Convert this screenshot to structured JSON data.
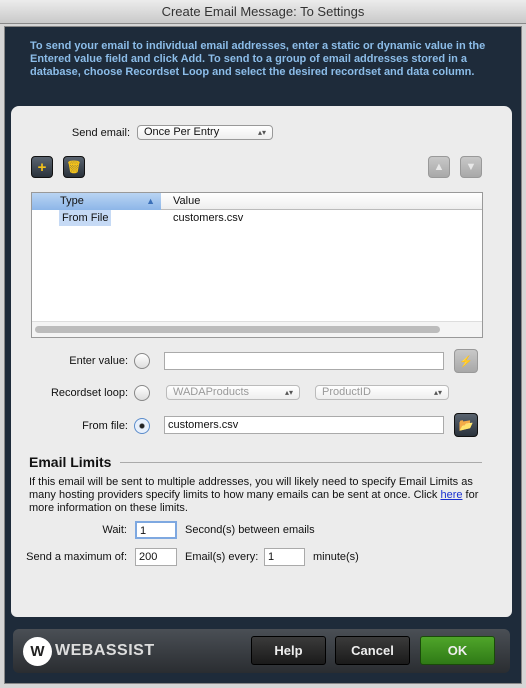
{
  "window": {
    "title": "Create Email Message: To Settings"
  },
  "intro": "To send your email to individual email addresses, enter a static or dynamic value in the Entered value field and click Add. To send to a group of email addresses stored in a database, choose Recordset Loop and select the desired recordset and data column.",
  "send_email": {
    "label": "Send email:",
    "value": "Once Per Entry"
  },
  "toolbar": {
    "add_icon": "plus-icon",
    "delete_icon": "trash-icon",
    "up_icon": "arrow-up-icon",
    "down_icon": "arrow-down-icon"
  },
  "table": {
    "columns": [
      "Type",
      "Value"
    ],
    "rows": [
      {
        "type": "From File",
        "value": "customers.csv"
      }
    ]
  },
  "enter_value": {
    "label": "Enter value:",
    "value": "",
    "selected": false
  },
  "recordset_loop": {
    "label": "Recordset loop:",
    "recordset": "WADAProducts",
    "column": "ProductID",
    "selected": false
  },
  "from_file": {
    "label": "From file:",
    "value": "customers.csv",
    "selected": true
  },
  "limits": {
    "heading": "Email Limits",
    "text_before": "If this email will be sent to multiple addresses, you will likely need to specify Email Limits as many hosting providers specify limits to how many emails can be sent at once. Click ",
    "link": "here",
    "text_after": " for more information on these limits.",
    "wait_label": "Wait:",
    "wait_value": "1",
    "wait_suffix": "Second(s) between emails",
    "max_label": "Send a maximum of:",
    "max_value": "200",
    "every_label": "Email(s) every:",
    "every_value": "1",
    "every_suffix": "minute(s)"
  },
  "footer": {
    "brand": "WEBASSIST",
    "help": "Help",
    "cancel": "Cancel",
    "ok": "OK",
    "ok_color": "#3f8f1f"
  }
}
